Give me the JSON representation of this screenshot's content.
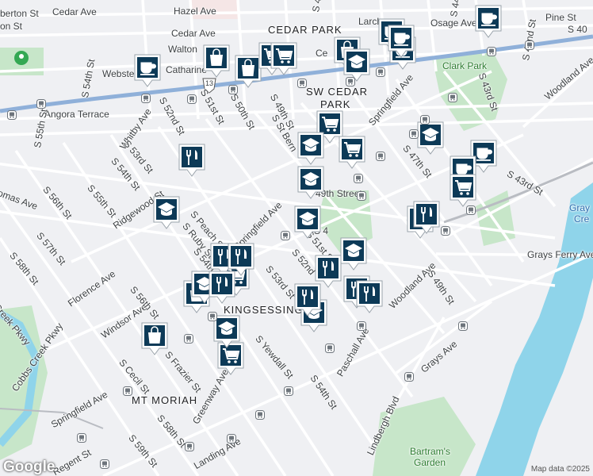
{
  "map": {
    "attribution": "Map data ©2025",
    "logo": "Google",
    "colors": {
      "land": "#eff0f3",
      "park": "#c7e6c9",
      "water": "#8fd4ea",
      "highway": "#8fb0d9",
      "road": "#ffffff",
      "accent": "#0d3a57"
    },
    "neighborhoods": [
      "CEDAR PARK",
      "SW CEDAR",
      "PARK",
      "KINGSESSING",
      "MT MORIAH"
    ],
    "places": [
      "Clark Park",
      "Bartram's",
      "Garden"
    ],
    "streets": [
      "Cedar Ave",
      "Hazel Ave",
      "Larch",
      "Osage Ave",
      "Pine St",
      "Cedar Ave",
      "Walton",
      "Catharine",
      "Webster",
      "Angora Terrace",
      "S 55th St",
      "S 54th St",
      "S 52nd St",
      "S 51st St",
      "S 50th St",
      "S 49th St",
      "S St Bern",
      "Springfield Ave",
      "Whitby Ave",
      "S 53rd St",
      "S 54th St",
      "S 55th St",
      "S 56th St",
      "S 57th St",
      "S 58th St",
      "Ridgewood St",
      "S Peach St",
      "S Ruby St",
      "S 54th",
      "Springfield Ave",
      "S 53rd St",
      "S 52nd",
      "S 51st St",
      "Florence Ave",
      "Windsor Ave",
      "S 56th St",
      "S Cecil St",
      "S Frazier St",
      "Greenway Ave",
      "S 58th St",
      "S 59th St",
      "Regent St",
      "Landing Ave",
      "Springfield Ave",
      "S Yewdall St",
      "S 54th St",
      "Paschall Ave",
      "Lindbergh Blvd",
      "Grays Ave",
      "Woodland Ave",
      "S 49th St",
      "Grays Ferry Ave",
      "S 47th St",
      "S 43rd St",
      "S 43rd St",
      "S 42nd St",
      "S 44th St",
      "Woodland Ave",
      "Cobbs Creek Pkwy",
      "Creek Pkwy",
      "omas Ave",
      "berton St",
      "on St",
      "S 48",
      "Ce",
      "S 40",
      "Gray",
      "Cre",
      "49th Street",
      "S 4"
    ],
    "route_shield": "13",
    "markers": [
      {
        "icon": "cafe-icon"
      },
      {
        "icon": "cafe-icon"
      },
      {
        "icon": "cafe-icon"
      },
      {
        "icon": "cafe-icon"
      },
      {
        "icon": "cafe-icon"
      },
      {
        "icon": "cafe-icon"
      },
      {
        "icon": "cafe-icon"
      },
      {
        "icon": "shopping-bag-icon"
      },
      {
        "icon": "shopping-bag-icon"
      },
      {
        "icon": "shopping-bag-icon"
      },
      {
        "icon": "shopping-bag-icon"
      },
      {
        "icon": "shopping-bag-icon"
      },
      {
        "icon": "shopping-cart-icon"
      },
      {
        "icon": "shopping-cart-icon"
      },
      {
        "icon": "shopping-cart-icon"
      },
      {
        "icon": "shopping-cart-icon"
      },
      {
        "icon": "shopping-cart-icon"
      },
      {
        "icon": "shopping-cart-icon"
      },
      {
        "icon": "shopping-cart-icon"
      },
      {
        "icon": "school-icon"
      },
      {
        "icon": "school-icon"
      },
      {
        "icon": "school-icon"
      },
      {
        "icon": "school-icon"
      },
      {
        "icon": "school-icon"
      },
      {
        "icon": "school-icon"
      },
      {
        "icon": "school-icon"
      },
      {
        "icon": "school-icon"
      },
      {
        "icon": "school-icon"
      },
      {
        "icon": "school-icon"
      },
      {
        "icon": "restaurant-icon"
      },
      {
        "icon": "restaurant-icon"
      },
      {
        "icon": "restaurant-icon"
      },
      {
        "icon": "restaurant-icon"
      },
      {
        "icon": "restaurant-icon"
      },
      {
        "icon": "restaurant-icon"
      },
      {
        "icon": "restaurant-icon"
      },
      {
        "icon": "restaurant-icon"
      },
      {
        "icon": "restaurant-icon"
      },
      {
        "icon": "restaurant-icon"
      }
    ]
  }
}
